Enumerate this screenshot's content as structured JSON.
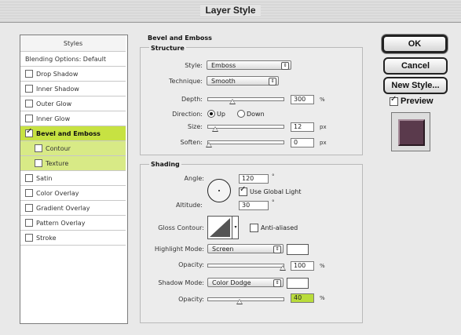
{
  "window": {
    "title": "Layer Style"
  },
  "styles_panel": {
    "header": "Styles",
    "items": [
      {
        "label": "Blending Options: Default",
        "has_checkbox": false,
        "checked": false
      },
      {
        "label": "Drop Shadow",
        "has_checkbox": true,
        "checked": false
      },
      {
        "label": "Inner Shadow",
        "has_checkbox": true,
        "checked": false
      },
      {
        "label": "Outer Glow",
        "has_checkbox": true,
        "checked": false
      },
      {
        "label": "Inner Glow",
        "has_checkbox": true,
        "checked": false
      },
      {
        "label": "Bevel and Emboss",
        "has_checkbox": true,
        "checked": true,
        "selected": true
      },
      {
        "label": "Contour",
        "has_checkbox": true,
        "checked": false,
        "sub": true
      },
      {
        "label": "Texture",
        "has_checkbox": true,
        "checked": false,
        "sub": true
      },
      {
        "label": "Satin",
        "has_checkbox": true,
        "checked": false
      },
      {
        "label": "Color Overlay",
        "has_checkbox": true,
        "checked": false
      },
      {
        "label": "Gradient Overlay",
        "has_checkbox": true,
        "checked": false
      },
      {
        "label": "Pattern Overlay",
        "has_checkbox": true,
        "checked": false
      },
      {
        "label": "Stroke",
        "has_checkbox": true,
        "checked": false
      }
    ]
  },
  "bevel": {
    "section_title": "Bevel and Emboss",
    "structure": {
      "title": "Structure",
      "style_label": "Style:",
      "style_value": "Emboss",
      "technique_label": "Technique:",
      "technique_value": "Smooth",
      "depth_label": "Depth:",
      "depth_value": "300",
      "depth_unit": "%",
      "direction_label": "Direction:",
      "dir_up": "Up",
      "dir_down": "Down",
      "size_label": "Size:",
      "size_value": "12",
      "size_unit": "px",
      "soften_label": "Soften:",
      "soften_value": "0",
      "soften_unit": "px"
    },
    "shading": {
      "title": "Shading",
      "angle_label": "Angle:",
      "angle_value": "120",
      "angle_unit": "°",
      "global_light_label": "Use Global Light",
      "altitude_label": "Altitude:",
      "altitude_value": "30",
      "altitude_unit": "°",
      "gloss_label": "Gloss Contour:",
      "anti_aliased_label": "Anti-aliased",
      "highlight_mode_label": "Highlight Mode:",
      "highlight_mode_value": "Screen",
      "highlight_opacity_label": "Opacity:",
      "highlight_opacity_value": "100",
      "highlight_opacity_unit": "%",
      "shadow_mode_label": "Shadow Mode:",
      "shadow_mode_value": "Color Dodge",
      "shadow_opacity_label": "Opacity:",
      "shadow_opacity_value": "40",
      "shadow_opacity_unit": "%"
    }
  },
  "buttons": {
    "ok": "OK",
    "cancel": "Cancel",
    "new_style": "New Style...",
    "preview": "Preview"
  },
  "colors": {
    "selected": "#c7e242",
    "highlighted_field": "#b9dc3a",
    "preview_swatch": "#5a3a4c"
  }
}
